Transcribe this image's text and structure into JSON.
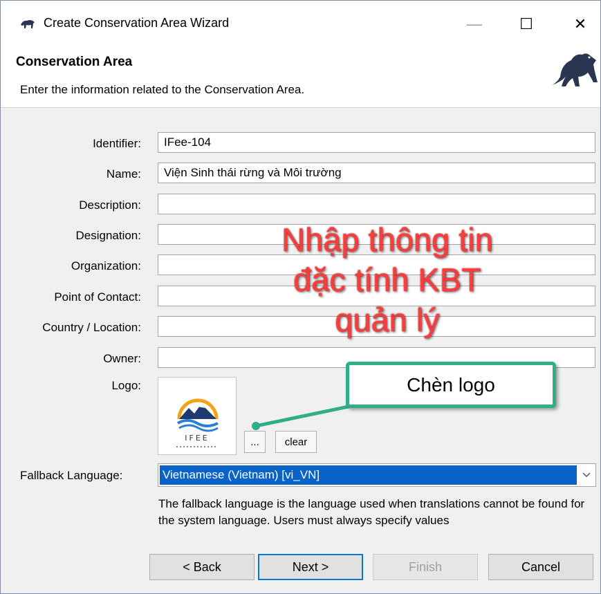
{
  "window": {
    "title": "Create Conservation Area Wizard",
    "controls": {
      "minimize": "—",
      "maximize": "☐",
      "close": "✕"
    }
  },
  "header": {
    "title": "Conservation Area",
    "description": "Enter the information related to the Conservation Area."
  },
  "form": {
    "identifier": {
      "label": "Identifier:",
      "value": "IFee-104"
    },
    "name": {
      "label": "Name:",
      "value": "Viện Sinh thái rừng và Môi trường"
    },
    "description": {
      "label": "Description:",
      "value": ""
    },
    "designation": {
      "label": "Designation:",
      "value": ""
    },
    "organization": {
      "label": "Organization:",
      "value": ""
    },
    "point_of_contact": {
      "label": "Point of Contact:",
      "value": ""
    },
    "country_location": {
      "label": "Country / Location:",
      "value": ""
    },
    "owner": {
      "label": "Owner:",
      "value": ""
    },
    "logo": {
      "label": "Logo:",
      "logo_text": "IFEE",
      "browse_label": "...",
      "clear_label": "clear"
    },
    "fallback_language": {
      "label": "Fallback Language:",
      "selected": "Vietnamese (Vietnam) [vi_VN]",
      "note": "The fallback language is the language used when translations cannot be found for the system language. Users must always specify values"
    }
  },
  "buttons": {
    "back": "< Back",
    "next": "Next >",
    "finish": "Finish",
    "cancel": "Cancel"
  },
  "annotations": {
    "main_text": [
      "Nhập thông tin",
      "đặc tính KBT",
      "quản lý"
    ],
    "callout_text": "Chèn logo"
  },
  "colors": {
    "accent": "#0078d7",
    "selection": "#0a63c9",
    "annotation_red": "#ff3b3b",
    "callout_green": "#2fae8a",
    "brand_dark": "#2a3550"
  },
  "icons": {
    "app": "panther-icon",
    "header": "panther-icon",
    "dropdown": "chevron-down-icon"
  }
}
